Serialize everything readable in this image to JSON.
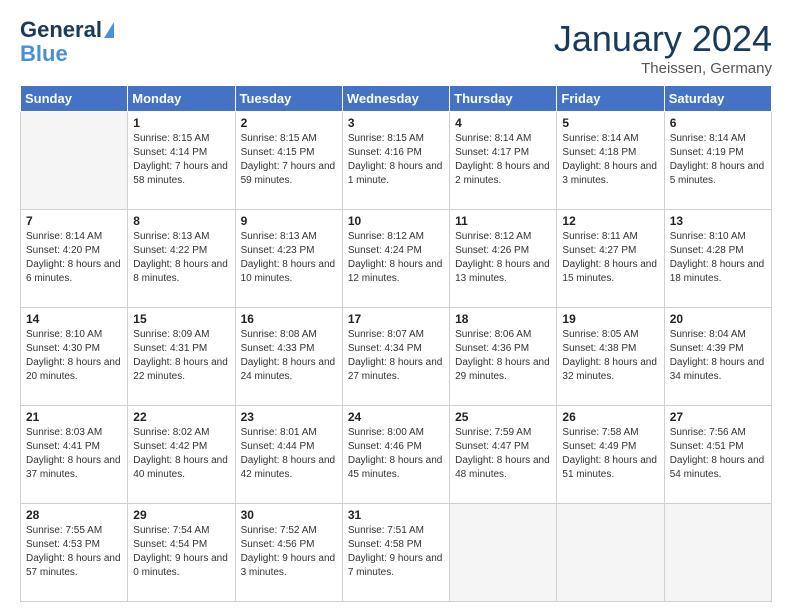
{
  "header": {
    "logo_line1": "General",
    "logo_line2": "Blue",
    "month_title": "January 2024",
    "subtitle": "Theissen, Germany"
  },
  "weekdays": [
    "Sunday",
    "Monday",
    "Tuesday",
    "Wednesday",
    "Thursday",
    "Friday",
    "Saturday"
  ],
  "weeks": [
    [
      {
        "day": "",
        "empty": true
      },
      {
        "day": "1",
        "sunrise": "8:15 AM",
        "sunset": "4:14 PM",
        "daylight": "7 hours and 58 minutes."
      },
      {
        "day": "2",
        "sunrise": "8:15 AM",
        "sunset": "4:15 PM",
        "daylight": "7 hours and 59 minutes."
      },
      {
        "day": "3",
        "sunrise": "8:15 AM",
        "sunset": "4:16 PM",
        "daylight": "8 hours and 1 minute."
      },
      {
        "day": "4",
        "sunrise": "8:14 AM",
        "sunset": "4:17 PM",
        "daylight": "8 hours and 2 minutes."
      },
      {
        "day": "5",
        "sunrise": "8:14 AM",
        "sunset": "4:18 PM",
        "daylight": "8 hours and 3 minutes."
      },
      {
        "day": "6",
        "sunrise": "8:14 AM",
        "sunset": "4:19 PM",
        "daylight": "8 hours and 5 minutes."
      }
    ],
    [
      {
        "day": "7",
        "sunrise": "8:14 AM",
        "sunset": "4:20 PM",
        "daylight": "8 hours and 6 minutes."
      },
      {
        "day": "8",
        "sunrise": "8:13 AM",
        "sunset": "4:22 PM",
        "daylight": "8 hours and 8 minutes."
      },
      {
        "day": "9",
        "sunrise": "8:13 AM",
        "sunset": "4:23 PM",
        "daylight": "8 hours and 10 minutes."
      },
      {
        "day": "10",
        "sunrise": "8:12 AM",
        "sunset": "4:24 PM",
        "daylight": "8 hours and 12 minutes."
      },
      {
        "day": "11",
        "sunrise": "8:12 AM",
        "sunset": "4:26 PM",
        "daylight": "8 hours and 13 minutes."
      },
      {
        "day": "12",
        "sunrise": "8:11 AM",
        "sunset": "4:27 PM",
        "daylight": "8 hours and 15 minutes."
      },
      {
        "day": "13",
        "sunrise": "8:10 AM",
        "sunset": "4:28 PM",
        "daylight": "8 hours and 18 minutes."
      }
    ],
    [
      {
        "day": "14",
        "sunrise": "8:10 AM",
        "sunset": "4:30 PM",
        "daylight": "8 hours and 20 minutes."
      },
      {
        "day": "15",
        "sunrise": "8:09 AM",
        "sunset": "4:31 PM",
        "daylight": "8 hours and 22 minutes."
      },
      {
        "day": "16",
        "sunrise": "8:08 AM",
        "sunset": "4:33 PM",
        "daylight": "8 hours and 24 minutes."
      },
      {
        "day": "17",
        "sunrise": "8:07 AM",
        "sunset": "4:34 PM",
        "daylight": "8 hours and 27 minutes."
      },
      {
        "day": "18",
        "sunrise": "8:06 AM",
        "sunset": "4:36 PM",
        "daylight": "8 hours and 29 minutes."
      },
      {
        "day": "19",
        "sunrise": "8:05 AM",
        "sunset": "4:38 PM",
        "daylight": "8 hours and 32 minutes."
      },
      {
        "day": "20",
        "sunrise": "8:04 AM",
        "sunset": "4:39 PM",
        "daylight": "8 hours and 34 minutes."
      }
    ],
    [
      {
        "day": "21",
        "sunrise": "8:03 AM",
        "sunset": "4:41 PM",
        "daylight": "8 hours and 37 minutes."
      },
      {
        "day": "22",
        "sunrise": "8:02 AM",
        "sunset": "4:42 PM",
        "daylight": "8 hours and 40 minutes."
      },
      {
        "day": "23",
        "sunrise": "8:01 AM",
        "sunset": "4:44 PM",
        "daylight": "8 hours and 42 minutes."
      },
      {
        "day": "24",
        "sunrise": "8:00 AM",
        "sunset": "4:46 PM",
        "daylight": "8 hours and 45 minutes."
      },
      {
        "day": "25",
        "sunrise": "7:59 AM",
        "sunset": "4:47 PM",
        "daylight": "8 hours and 48 minutes."
      },
      {
        "day": "26",
        "sunrise": "7:58 AM",
        "sunset": "4:49 PM",
        "daylight": "8 hours and 51 minutes."
      },
      {
        "day": "27",
        "sunrise": "7:56 AM",
        "sunset": "4:51 PM",
        "daylight": "8 hours and 54 minutes."
      }
    ],
    [
      {
        "day": "28",
        "sunrise": "7:55 AM",
        "sunset": "4:53 PM",
        "daylight": "8 hours and 57 minutes."
      },
      {
        "day": "29",
        "sunrise": "7:54 AM",
        "sunset": "4:54 PM",
        "daylight": "9 hours and 0 minutes."
      },
      {
        "day": "30",
        "sunrise": "7:52 AM",
        "sunset": "4:56 PM",
        "daylight": "9 hours and 3 minutes."
      },
      {
        "day": "31",
        "sunrise": "7:51 AM",
        "sunset": "4:58 PM",
        "daylight": "9 hours and 7 minutes."
      },
      {
        "day": "",
        "empty": true
      },
      {
        "day": "",
        "empty": true
      },
      {
        "day": "",
        "empty": true
      }
    ]
  ],
  "labels": {
    "sunrise": "Sunrise:",
    "sunset": "Sunset:",
    "daylight": "Daylight:"
  }
}
